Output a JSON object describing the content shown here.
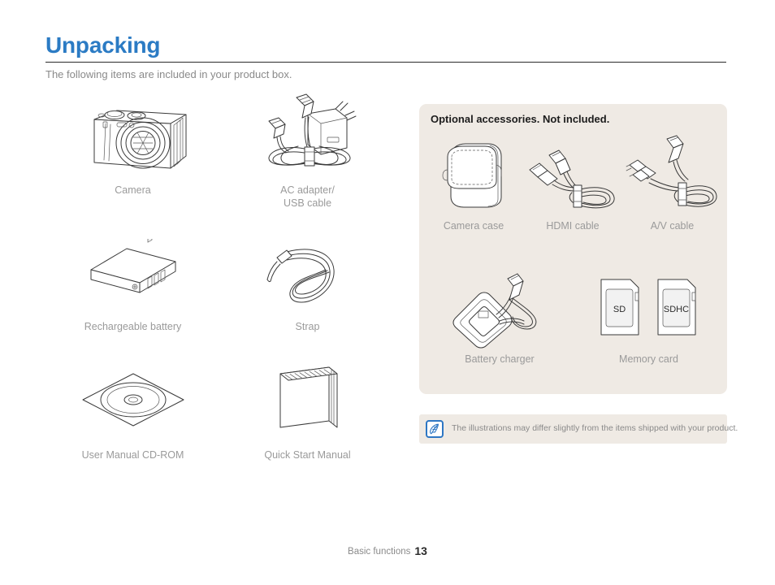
{
  "header": {
    "title": "Unpacking",
    "subtitle": "The following items are included in your product box.",
    "title_color": "#2b7bc4"
  },
  "included_items": [
    {
      "label": "Camera",
      "icon": "camera-icon"
    },
    {
      "label": "AC adapter/\nUSB cable",
      "icon": "ac-adapter-usb-cable-icon"
    },
    {
      "label": "Rechargeable battery",
      "icon": "battery-icon"
    },
    {
      "label": "Strap",
      "icon": "strap-icon"
    },
    {
      "label": "User Manual CD-ROM",
      "icon": "cd-rom-icon"
    },
    {
      "label": "Quick Start Manual",
      "icon": "quick-start-manual-icon"
    }
  ],
  "optional": {
    "heading": "Optional accessories. Not included.",
    "panel_color": "#efeae4",
    "items": [
      {
        "label": "Camera case",
        "icon": "camera-case-icon"
      },
      {
        "label": "HDMI cable",
        "icon": "hdmi-cable-icon"
      },
      {
        "label": "A/V cable",
        "icon": "av-cable-icon"
      },
      {
        "label": "Battery charger",
        "icon": "battery-charger-icon"
      },
      {
        "label": "Memory card",
        "icon": "memory-card-icon"
      }
    ],
    "memory_card_labels": {
      "sd": "SD",
      "sdhc": "SDHC"
    }
  },
  "note": {
    "icon": "note-quill-icon",
    "icon_color": "#2e77c4",
    "text": "The illustrations may differ slightly from the items shipped with your product."
  },
  "footer": {
    "section": "Basic functions",
    "page": "13"
  }
}
